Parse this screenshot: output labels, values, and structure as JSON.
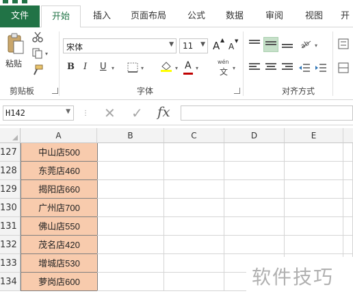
{
  "colors": {
    "file_tab_bg": "#217346",
    "accent": "#217346",
    "highlight_fill": "#f8cbad",
    "align_selected": "#c6e0c9",
    "font_color_red": "#c00000"
  },
  "ribbon_tabs": [
    "文件",
    "开始",
    "插入",
    "页面布局",
    "公式",
    "数据",
    "审阅",
    "视图",
    "开"
  ],
  "ribbon": {
    "paste_label": "粘贴",
    "font_name": "宋体",
    "font_size": "11",
    "grow_font_label": "A",
    "shrink_font_label": "A",
    "bold_label": "B",
    "italic_label": "I",
    "underline_label": "U",
    "font_color_label": "A",
    "phonetic_label": "wén",
    "phonetic_char": "文",
    "groups": {
      "clipboard": "剪贴板",
      "font": "字体",
      "alignment": "对齐方式"
    }
  },
  "formula_bar": {
    "name_box": "H142",
    "fx_label": "fx",
    "formula_value": ""
  },
  "columns": [
    "A",
    "B",
    "C",
    "D",
    "E"
  ],
  "rows": [
    {
      "row": "127",
      "a": "中山店500"
    },
    {
      "row": "128",
      "a": "东莞店460"
    },
    {
      "row": "129",
      "a": "揭阳店660"
    },
    {
      "row": "130",
      "a": "广州店700"
    },
    {
      "row": "131",
      "a": "佛山店550"
    },
    {
      "row": "132",
      "a": "茂名店420"
    },
    {
      "row": "133",
      "a": "增城店530"
    },
    {
      "row": "134",
      "a": "萝岗店600"
    }
  ],
  "watermark": "软件技巧"
}
